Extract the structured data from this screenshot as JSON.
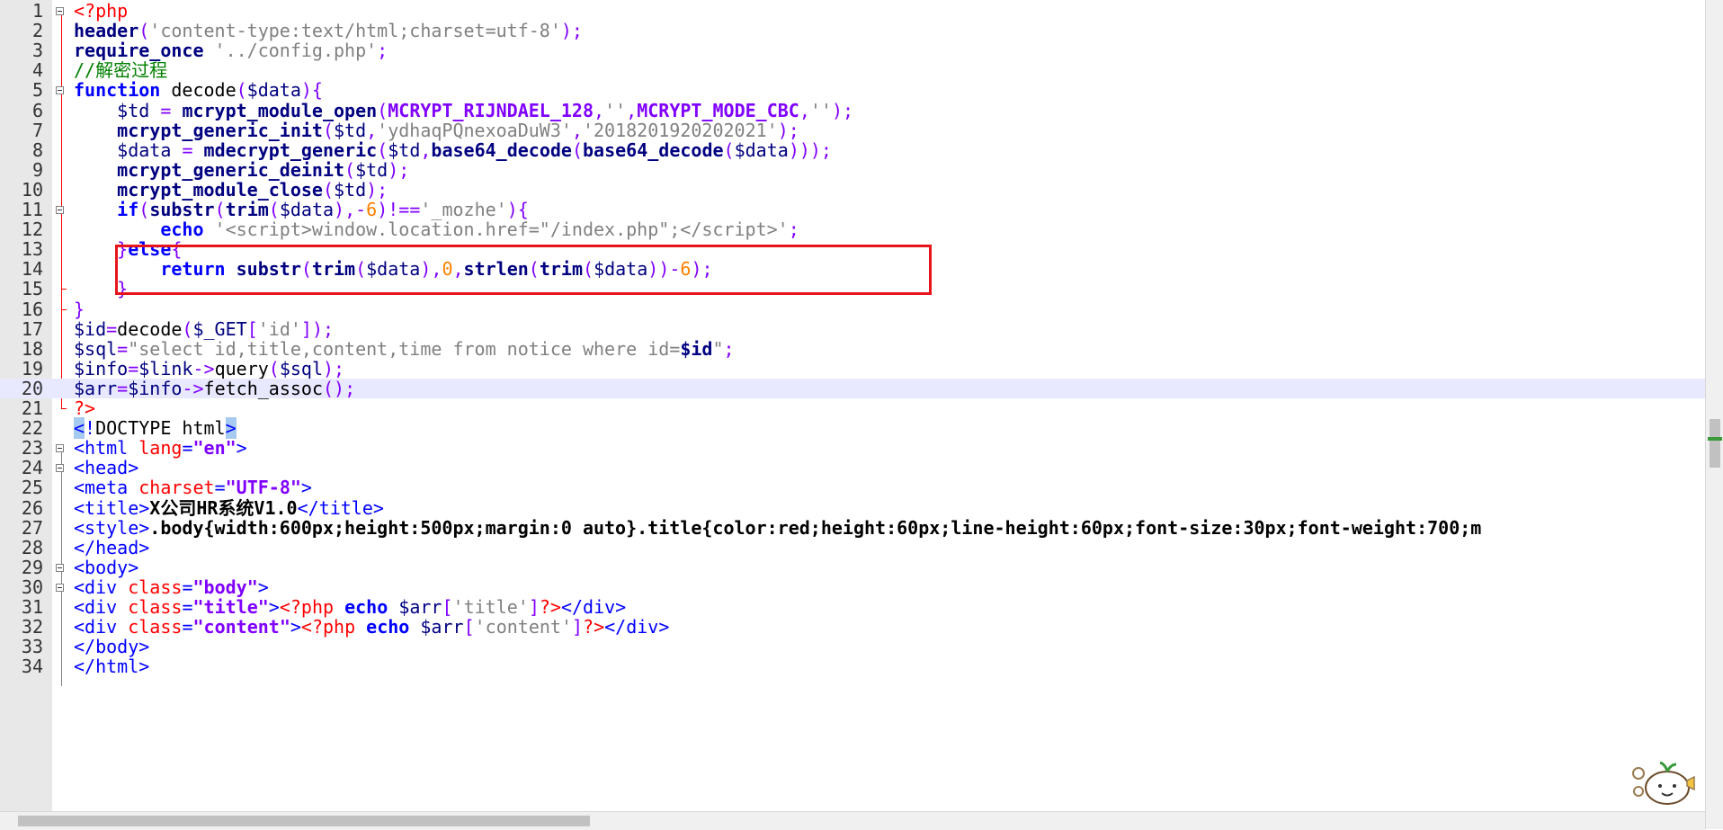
{
  "editor": {
    "current_line": 20,
    "lines": [
      {
        "n": "1",
        "html": "<span class=\"phptag\">&lt;?php</span>"
      },
      {
        "n": "2",
        "html": "<span class=\"fn\">header</span><span class=\"op\">(</span><span class=\"str\">'content-type:text/html;charset=utf-8'</span><span class=\"op\">);</span>"
      },
      {
        "n": "3",
        "html": "<span class=\"fn\">require_once</span> <span class=\"str\">'../config.php'</span><span class=\"op\">;</span>"
      },
      {
        "n": "4",
        "html": "<span class=\"cmt\">//解密过程</span>"
      },
      {
        "n": "5",
        "html": "<span class=\"kw\">function</span> decode<span class=\"op\">(</span><span class=\"var\">$data</span><span class=\"op\">){</span>"
      },
      {
        "n": "6",
        "html": "    <span class=\"var\">$td</span> <span class=\"op\">=</span> <span class=\"fn\">mcrypt_module_open</span><span class=\"op\">(</span><span class=\"const\">MCRYPT_RIJNDAEL_128</span><span class=\"op\">,</span><span class=\"str\">''</span><span class=\"op\">,</span><span class=\"const\">MCRYPT_MODE_CBC</span><span class=\"op\">,</span><span class=\"str\">''</span><span class=\"op\">);</span>"
      },
      {
        "n": "7",
        "html": "    <span class=\"fn\">mcrypt_generic_init</span><span class=\"op\">(</span><span class=\"var\">$td</span><span class=\"op\">,</span><span class=\"str\">'ydhaqPQnexoaDuW3'</span><span class=\"op\">,</span><span class=\"str\">'2018201920202021'</span><span class=\"op\">);</span>"
      },
      {
        "n": "8",
        "html": "    <span class=\"var\">$data</span> <span class=\"op\">=</span> <span class=\"fn\">mdecrypt_generic</span><span class=\"op\">(</span><span class=\"var\">$td</span><span class=\"op\">,</span><span class=\"fn\">base64_decode</span><span class=\"op\">(</span><span class=\"fn\">base64_decode</span><span class=\"op\">(</span><span class=\"var\">$data</span><span class=\"op\">)));</span>"
      },
      {
        "n": "9",
        "html": "    <span class=\"fn\">mcrypt_generic_deinit</span><span class=\"op\">(</span><span class=\"var\">$td</span><span class=\"op\">);</span>"
      },
      {
        "n": "10",
        "html": "    <span class=\"fn\">mcrypt_module_close</span><span class=\"op\">(</span><span class=\"var\">$td</span><span class=\"op\">);</span>"
      },
      {
        "n": "11",
        "html": "    <span class=\"kw\">if</span><span class=\"op\">(</span><span class=\"fn\">substr</span><span class=\"op\">(</span><span class=\"fn\">trim</span><span class=\"op\">(</span><span class=\"var\">$data</span><span class=\"op\">),-</span><span class=\"num-lit\">6</span><span class=\"op\">)!==</span><span class=\"str\">'_mozhe'</span><span class=\"op\">){</span>"
      },
      {
        "n": "12",
        "html": "        <span class=\"kw\">echo</span> <span class=\"str\">'&lt;script&gt;window.location.href=\"/index.php\";&lt;/script&gt;'</span><span class=\"op\">;</span>"
      },
      {
        "n": "13",
        "html": "    <span class=\"op\">}</span><span class=\"kw\">else</span><span class=\"op\">{</span>"
      },
      {
        "n": "14",
        "html": "        <span class=\"kw\">return</span> <span class=\"fn\">substr</span><span class=\"op\">(</span><span class=\"fn\">trim</span><span class=\"op\">(</span><span class=\"var\">$data</span><span class=\"op\">),</span><span class=\"num-lit\">0</span><span class=\"op\">,</span><span class=\"fn\">strlen</span><span class=\"op\">(</span><span class=\"fn\">trim</span><span class=\"op\">(</span><span class=\"var\">$data</span><span class=\"op\">))-</span><span class=\"num-lit\">6</span><span class=\"op\">);</span>"
      },
      {
        "n": "15",
        "html": "    <span class=\"op\">}</span>"
      },
      {
        "n": "16",
        "html": "<span class=\"op\">}</span>"
      },
      {
        "n": "17",
        "html": "<span class=\"var\">$id</span><span class=\"op\">=</span>decode<span class=\"op\">(</span><span class=\"var\">$_GET</span><span class=\"op\">[</span><span class=\"str\">'id'</span><span class=\"op\">]);</span>"
      },
      {
        "n": "18",
        "html": "<span class=\"var\">$sql</span><span class=\"op\">=</span><span class=\"str\">\"select id,title,content,time from notice where id=</span><span class=\"var bold\">$id</span><span class=\"str\">\"</span><span class=\"op\">;</span>"
      },
      {
        "n": "19",
        "html": "<span class=\"var\">$info</span><span class=\"op\">=</span><span class=\"var\">$link</span><span class=\"op\">-&gt;</span>query<span class=\"op\">(</span><span class=\"var\">$sql</span><span class=\"op\">);</span>"
      },
      {
        "n": "20",
        "html": "<span class=\"var\">$arr</span><span class=\"op\">=</span><span class=\"var\">$info</span><span class=\"op\">-&gt;</span>fetch_assoc<span class=\"op\">();</span>"
      },
      {
        "n": "21",
        "html": "<span class=\"phptag\">?&gt;</span>"
      },
      {
        "n": "22",
        "html": "<span class=\"tag dtype\">&lt;</span><span class=\"tag\">!</span>DOCTYPE html<span class=\"tag dtype\">&gt;</span>"
      },
      {
        "n": "23",
        "html": "<span class=\"tag\">&lt;html</span> <span class=\"attr\">lang</span><span class=\"tag\">=</span><span class=\"aval\">\"en\"</span><span class=\"tag\">&gt;</span>"
      },
      {
        "n": "24",
        "html": "<span class=\"tag\">&lt;head&gt;</span>"
      },
      {
        "n": "25",
        "html": "<span class=\"tag\">&lt;meta</span> <span class=\"attr\">charset</span><span class=\"tag\">=</span><span class=\"aval\">\"UTF-8\"</span><span class=\"tag\">&gt;</span>"
      },
      {
        "n": "26",
        "html": "<span class=\"tag\">&lt;title&gt;</span><span class=\"bold\">X公司HR系统V1.0</span><span class=\"tag\">&lt;/title&gt;</span>"
      },
      {
        "n": "27",
        "html": "<span class=\"tag\">&lt;style&gt;</span><span class=\"bold\">.body{width:600px;height:500px;margin:0 auto}.title{color:red;height:60px;line-height:60px;font-size:30px;font-weight:700;m</span>"
      },
      {
        "n": "28",
        "html": "<span class=\"tag\">&lt;/head&gt;</span>"
      },
      {
        "n": "29",
        "html": "<span class=\"tag\">&lt;body&gt;</span>"
      },
      {
        "n": "30",
        "html": "<span class=\"tag\">&lt;div</span> <span class=\"attr\">class</span><span class=\"tag\">=</span><span class=\"aval\">\"body\"</span><span class=\"tag\">&gt;</span>"
      },
      {
        "n": "31",
        "html": "<span class=\"tag\">&lt;div</span> <span class=\"attr\">class</span><span class=\"tag\">=</span><span class=\"aval\">\"title\"</span><span class=\"tag\">&gt;</span><span class=\"phptag\">&lt;?php</span> <span class=\"kw\">echo</span> <span class=\"var\">$arr</span><span class=\"op\">[</span><span class=\"str\">'title'</span><span class=\"op\">]</span><span class=\"phptag\">?&gt;</span><span class=\"tag\">&lt;/div&gt;</span>"
      },
      {
        "n": "32",
        "html": "<span class=\"tag\">&lt;div</span> <span class=\"attr\">class</span><span class=\"tag\">=</span><span class=\"aval\">\"content\"</span><span class=\"tag\">&gt;</span><span class=\"phptag\">&lt;?php</span> <span class=\"kw\">echo</span> <span class=\"var\">$arr</span><span class=\"op\">[</span><span class=\"str\">'content'</span><span class=\"op\">]</span><span class=\"phptag\">?&gt;</span><span class=\"tag\">&lt;/div&gt;</span>"
      },
      {
        "n": "33",
        "html": "<span class=\"tag\">&lt;/body&gt;</span>"
      },
      {
        "n": "34",
        "html": "<span class=\"tag\">&lt;/html&gt;</span>"
      }
    ],
    "fold_markers": [
      1,
      5,
      11,
      23,
      24,
      29,
      30
    ],
    "highlight_box": {
      "from_line": 11,
      "to_line": 12
    }
  },
  "colors": {
    "highlight_box": "#e8141c",
    "current_line": "#e8e8ff",
    "gutter": "#e8e8e8"
  },
  "icons": {
    "mascot": "mascot-icon"
  }
}
